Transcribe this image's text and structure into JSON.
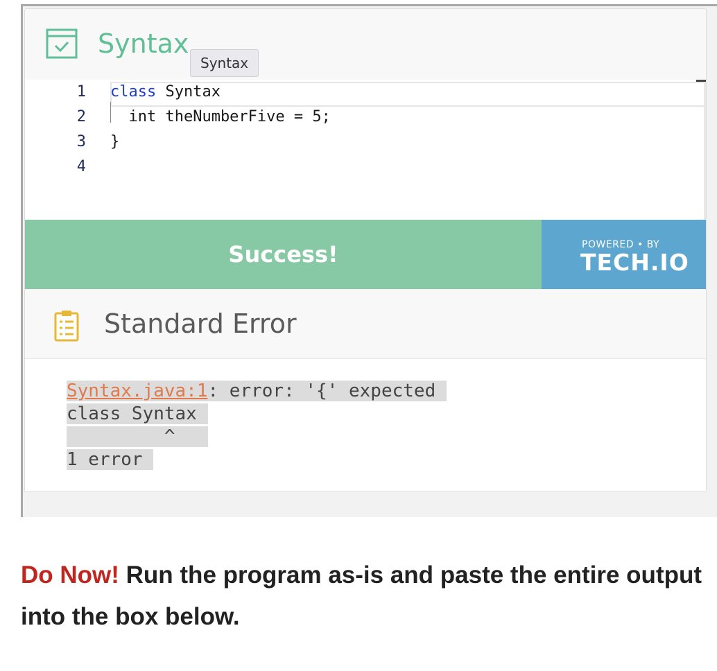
{
  "widget": {
    "title": "Syntax",
    "tooltip": "Syntax"
  },
  "editor": {
    "lines": [
      {
        "num": "1",
        "keyword": "class",
        "rest": " Syntax"
      },
      {
        "num": "2",
        "keyword": "",
        "rest": "  int theNumberFive = 5;"
      },
      {
        "num": "3",
        "keyword": "",
        "rest": "}"
      },
      {
        "num": "4",
        "keyword": "",
        "rest": ""
      }
    ]
  },
  "run": {
    "status": "Success!",
    "powered_by": "POWERED • BY",
    "brand": "TECH.IO"
  },
  "stderr": {
    "title": "Standard Error",
    "link": "Syntax.java:1",
    "line1_rest": ": error: '{' expected",
    "line2": "class Syntax",
    "line3": "         ^",
    "line4": "1 error"
  },
  "instructions": {
    "do_now": "Do Now!",
    "text": " Run the program as-is and paste the entire output into the box below."
  },
  "colors": {
    "accent_green": "#5fbf97",
    "success_bg": "#86c9a4",
    "techio_blue": "#5da6cf",
    "do_now_red": "#c0261f"
  }
}
